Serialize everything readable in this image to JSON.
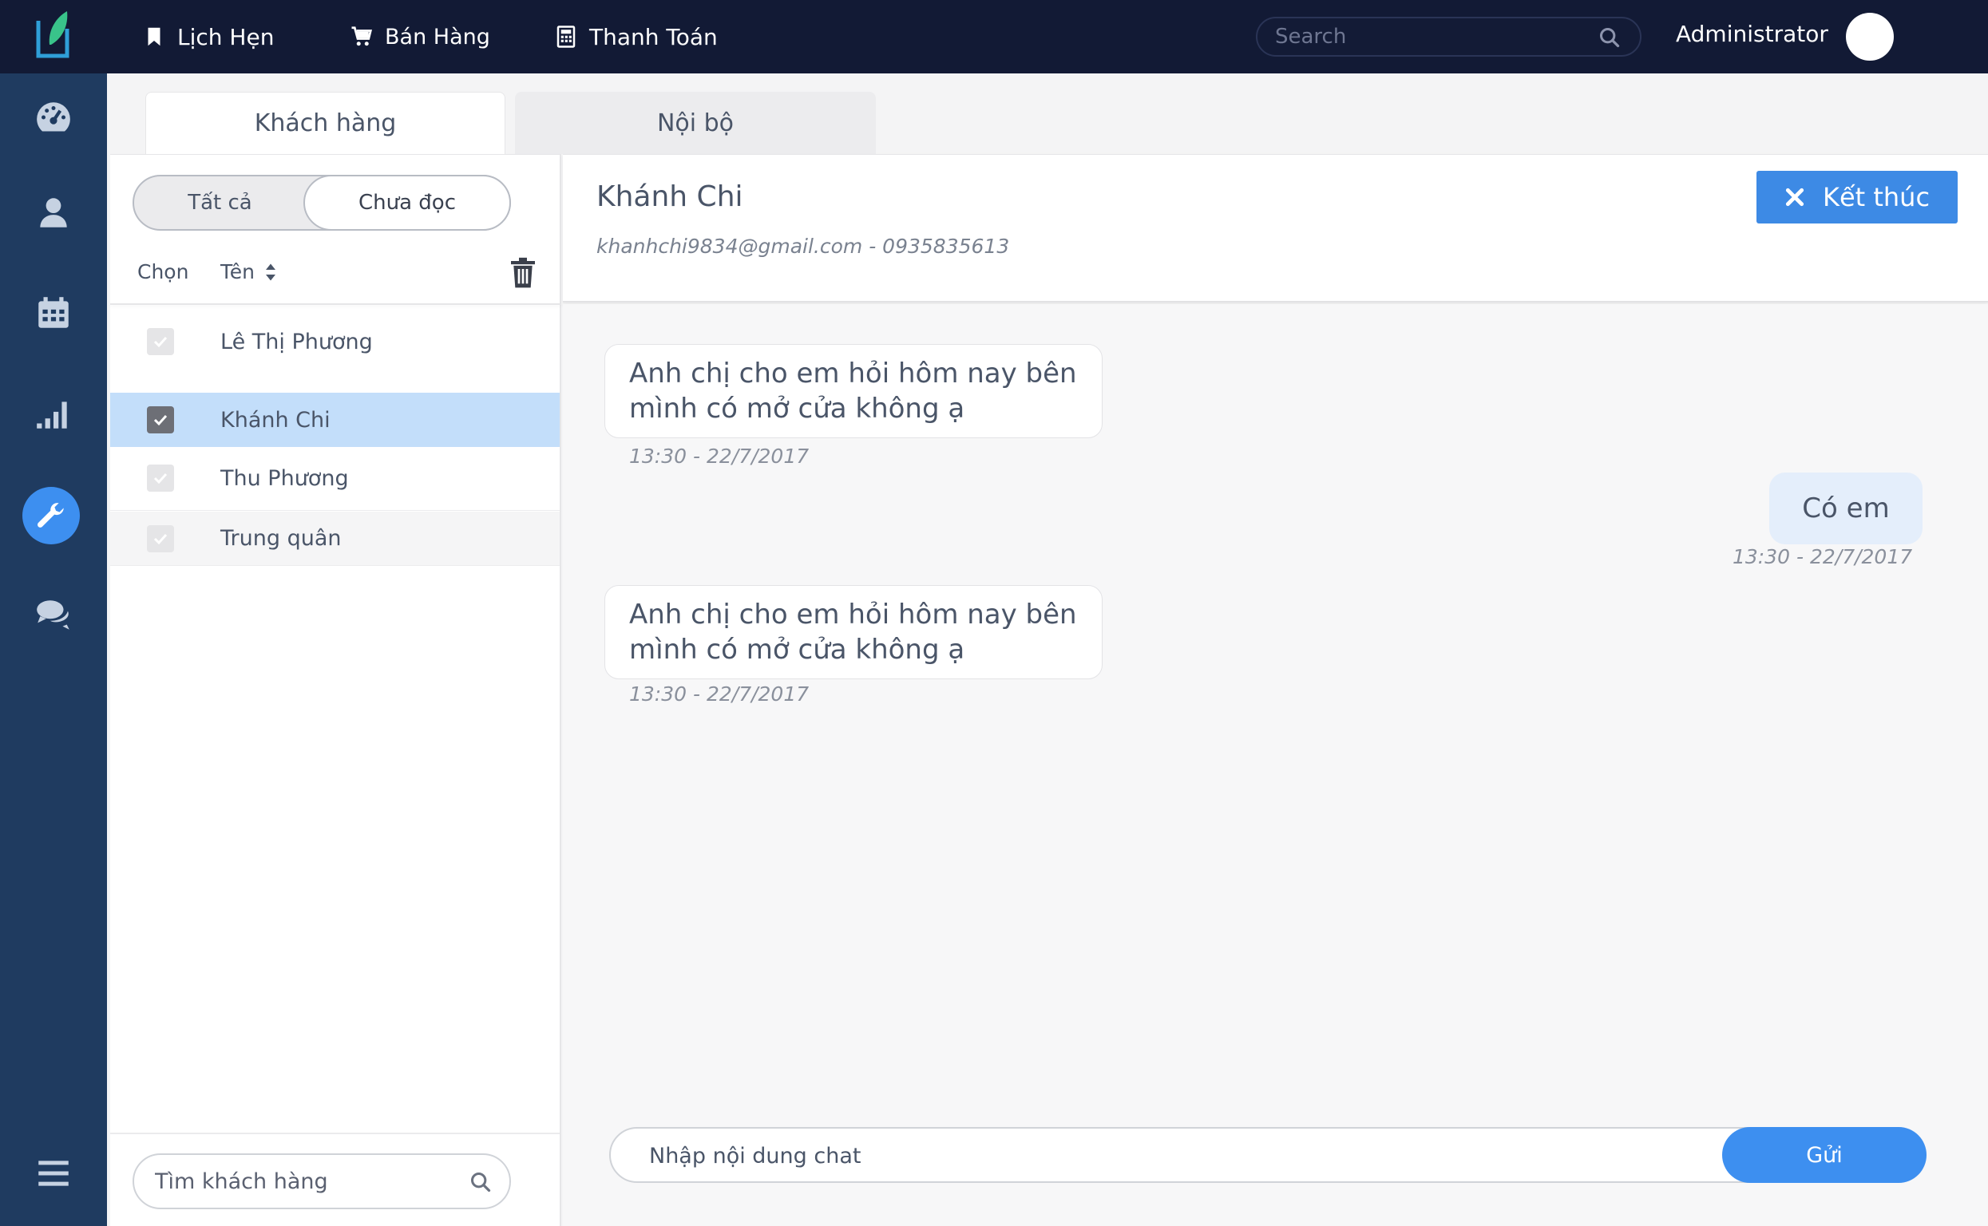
{
  "colors": {
    "topbar": "#121a35",
    "sidebar": "#1f3b60",
    "accent": "#3d8ff0",
    "selected_row": "#c3defa",
    "outgoing_bubble": "#e4eefb"
  },
  "topbar": {
    "logo_icon": "leaf-logo-icon",
    "nav": [
      {
        "label": "Lịch Hẹn",
        "icon": "bookmark-icon"
      },
      {
        "label": "Bán Hàng",
        "icon": "cart-icon"
      },
      {
        "label": "Thanh Toán",
        "icon": "calculator-icon"
      }
    ],
    "search_placeholder": "Search",
    "user_name": "Administrator"
  },
  "sidebar": {
    "items": [
      {
        "icon": "dashboard-icon",
        "active": false
      },
      {
        "icon": "user-icon",
        "active": false
      },
      {
        "icon": "calendar-icon",
        "active": false
      },
      {
        "icon": "signal-icon",
        "active": false
      },
      {
        "icon": "wrench-icon",
        "active": true
      },
      {
        "icon": "chat-icon",
        "active": false
      },
      {
        "icon": "menu-icon",
        "active": false
      }
    ]
  },
  "tabs": [
    {
      "label": "Khách hàng",
      "active": true
    },
    {
      "label": "Nội bộ",
      "active": false
    }
  ],
  "filter": {
    "all_label": "Tất cả",
    "unread_label": "Chưa đọc",
    "selected": "Chưa đọc"
  },
  "list_header": {
    "select_label": "Chọn",
    "name_label": "Tên"
  },
  "customers": [
    {
      "name": "Lê Thị Phương",
      "checked": false,
      "selected": false
    },
    {
      "name": "Khánh Chi",
      "checked": true,
      "selected": true
    },
    {
      "name": "Thu Phương",
      "checked": false,
      "selected": false
    },
    {
      "name": "Trung quân",
      "checked": false,
      "selected": false
    }
  ],
  "customer_search_placeholder": "Tìm khách hàng",
  "chat": {
    "contact_name": "Khánh Chi",
    "contact_info": "khanhchi9834@gmail.com - 0935835613",
    "end_button": "Kết thúc",
    "messages": [
      {
        "direction": "in",
        "text": "Anh chị cho em hỏi hôm nay bên mình có mở cửa không ạ",
        "time": "13:30 - 22/7/2017"
      },
      {
        "direction": "out",
        "text": "Có em",
        "time": "13:30 - 22/7/2017"
      },
      {
        "direction": "in",
        "text": "Anh chị cho em hỏi hôm nay bên mình có mở cửa không ạ",
        "time": "13:30 - 22/7/2017"
      }
    ],
    "input_placeholder": "Nhập nội dung chat",
    "send_label": "Gửi"
  }
}
